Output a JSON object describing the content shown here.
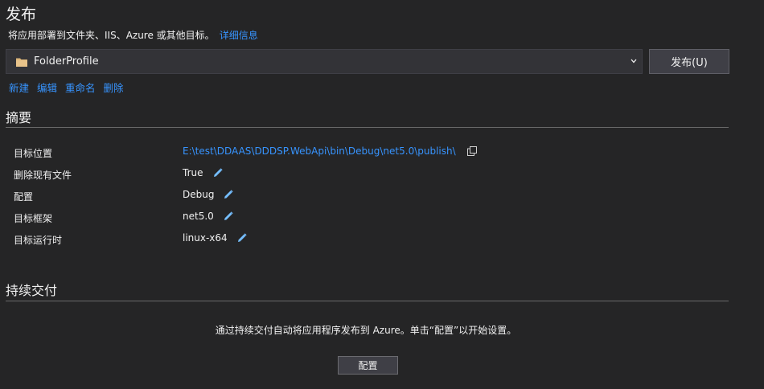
{
  "header": {
    "title": "发布",
    "subtitle": "将应用部署到文件夹、IIS、Azure 或其他目标。",
    "details_link": "详细信息"
  },
  "profile": {
    "selected": "FolderProfile",
    "publish_button": "发布(U)",
    "actions": [
      "新建",
      "编辑",
      "重命名",
      "删除"
    ]
  },
  "summary": {
    "title": "摘要",
    "rows": [
      {
        "label": "目标位置",
        "value": "E:\\test\\DDAAS\\DDDSP.WebApi\\bin\\Debug\\net5.0\\publish\\"
      },
      {
        "label": "删除现有文件",
        "value": "True"
      },
      {
        "label": "配置",
        "value": "Debug"
      },
      {
        "label": "目标框架",
        "value": "net5.0"
      },
      {
        "label": "目标运行时",
        "value": "linux-x64"
      }
    ]
  },
  "continuous_delivery": {
    "title": "持续交付",
    "description": "通过持续交付自动将应用程序发布到 Azure。单击“配置”以开始设置。",
    "config_button": "配置"
  },
  "colors": {
    "background": "#252526",
    "link": "#3794ff",
    "text": "#f1f1f1"
  },
  "icons": {
    "folder": "folder-icon",
    "chevron": "chevron-down-icon",
    "edit": "pencil-icon",
    "copy": "copy-icon"
  }
}
